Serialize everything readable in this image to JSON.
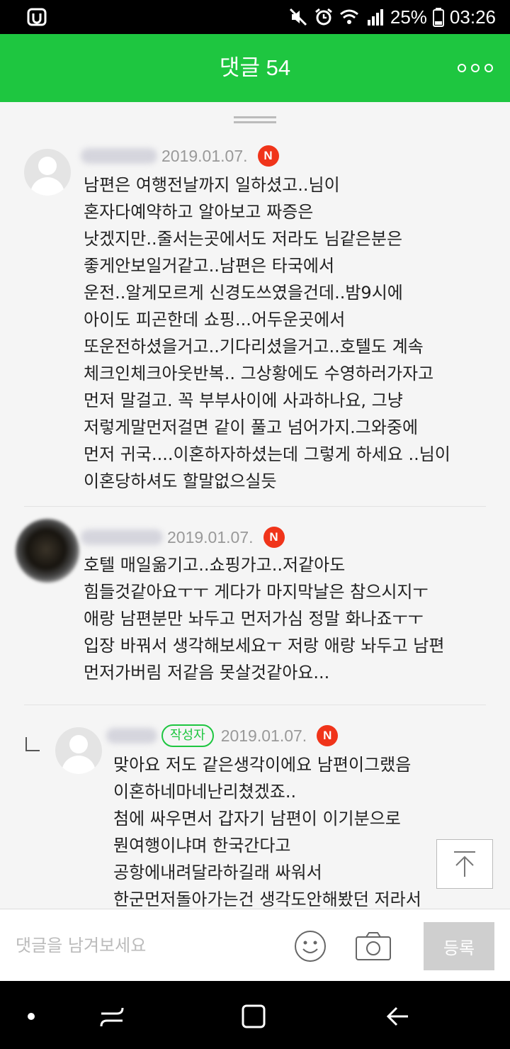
{
  "status_bar": {
    "battery": "25%",
    "time": "03:26",
    "icons": [
      "app-notification-icon",
      "mute-icon",
      "alarm-icon",
      "wifi-icon",
      "signal-icon",
      "battery-icon"
    ]
  },
  "header": {
    "title": "댓글 54",
    "background": "#1ec640",
    "more_icon": "more-dots-icon"
  },
  "comments": [
    {
      "date": "2019.01.07.",
      "new_badge": "N",
      "text": "남편은 여행전날까지 일하셨고..님이\n혼자다예약하고 알아보고 짜증은\n낫겠지만..줄서는곳에서도 저라도 님같은분은\n좋게안보일거같고..남편은 타국에서\n운전..알게모르게 신경도쓰였을건데..밤9시에\n아이도 피곤한데 쇼핑...어두운곳에서\n또운전하셨을거고..기다리셨을거고..호텔도 계속\n체크인체크아웃반복.. 그상황에도 수영하러가자고\n먼저 말걸고. 꼭 부부사이에 사과하나요, 그냥\n저렇게말먼저걸면 같이 풀고 넘어가지.그와중에\n먼저 귀국....이혼하자하셨는데 그렇게 하세요 ..님이\n이혼당하셔도 할말없으실듯"
    },
    {
      "date": "2019.01.07.",
      "new_badge": "N",
      "text": "호텔 매일옮기고..쇼핑가고..저같아도\n힘들것같아요ㅜㅜ 게다가 마지막날은 참으시지ㅜ\n애랑 남편분만 놔두고 먼저가심 정말 화나죠ㅜㅜ\n입장 바꿔서 생각해보세요ㅜ 저랑 애랑 놔두고 남편\n먼저가버림 저같음 못살것같아요..."
    },
    {
      "author_badge": "작성자",
      "date": "2019.01.07.",
      "new_badge": "N",
      "text": "맞아요 저도 같은생각이에요 남편이그랬음\n이혼하네마네난리쳤겠죠..\n첨에 싸우면서 갑자기 남편이 이기분으로\n뭔여행이냐며 한국간다고\n공항에내려달라하길래 싸워서\n한군먼저돌아가는건 생각도안해봤던 저라서"
    }
  ],
  "input_bar": {
    "placeholder": "댓글을 남겨보세요",
    "value": "",
    "register_label": "등록"
  }
}
